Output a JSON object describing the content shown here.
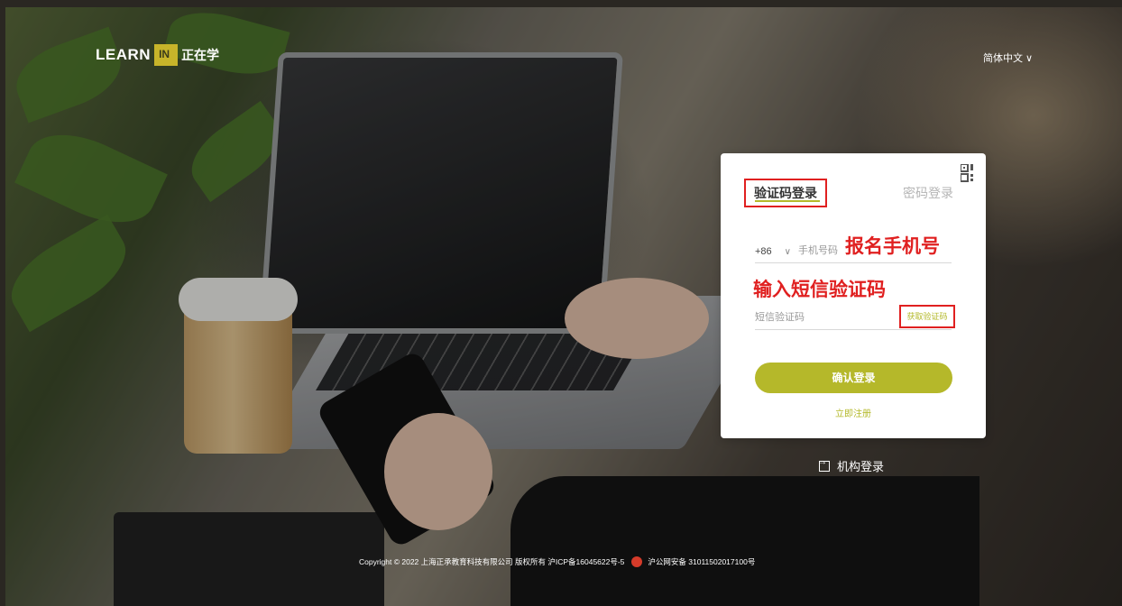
{
  "brand": {
    "learn": "LEARN",
    "in": "IN",
    "cn": "正在学"
  },
  "header": {
    "language": "简体中文 ∨"
  },
  "login": {
    "tab_sms": "验证码登录",
    "tab_password": "密码登录",
    "country_code": "+86",
    "country_chevron": "∨",
    "phone_placeholder": "手机号码",
    "annotation_phone": "报名手机号",
    "annotation_sms": "输入短信验证码",
    "sms_placeholder": "短信验证码",
    "get_code": "获取验证码",
    "submit": "确认登录",
    "register": "立即注册"
  },
  "org_login": "机构登录",
  "footer": {
    "copyright": "Copyright © 2022 上海正承教育科技有限公司 版权所有   沪ICP备16045622号-5",
    "police": "沪公网安备 31011502017100号"
  },
  "colors": {
    "accent": "#b5b82a",
    "annotation": "#e02020"
  }
}
